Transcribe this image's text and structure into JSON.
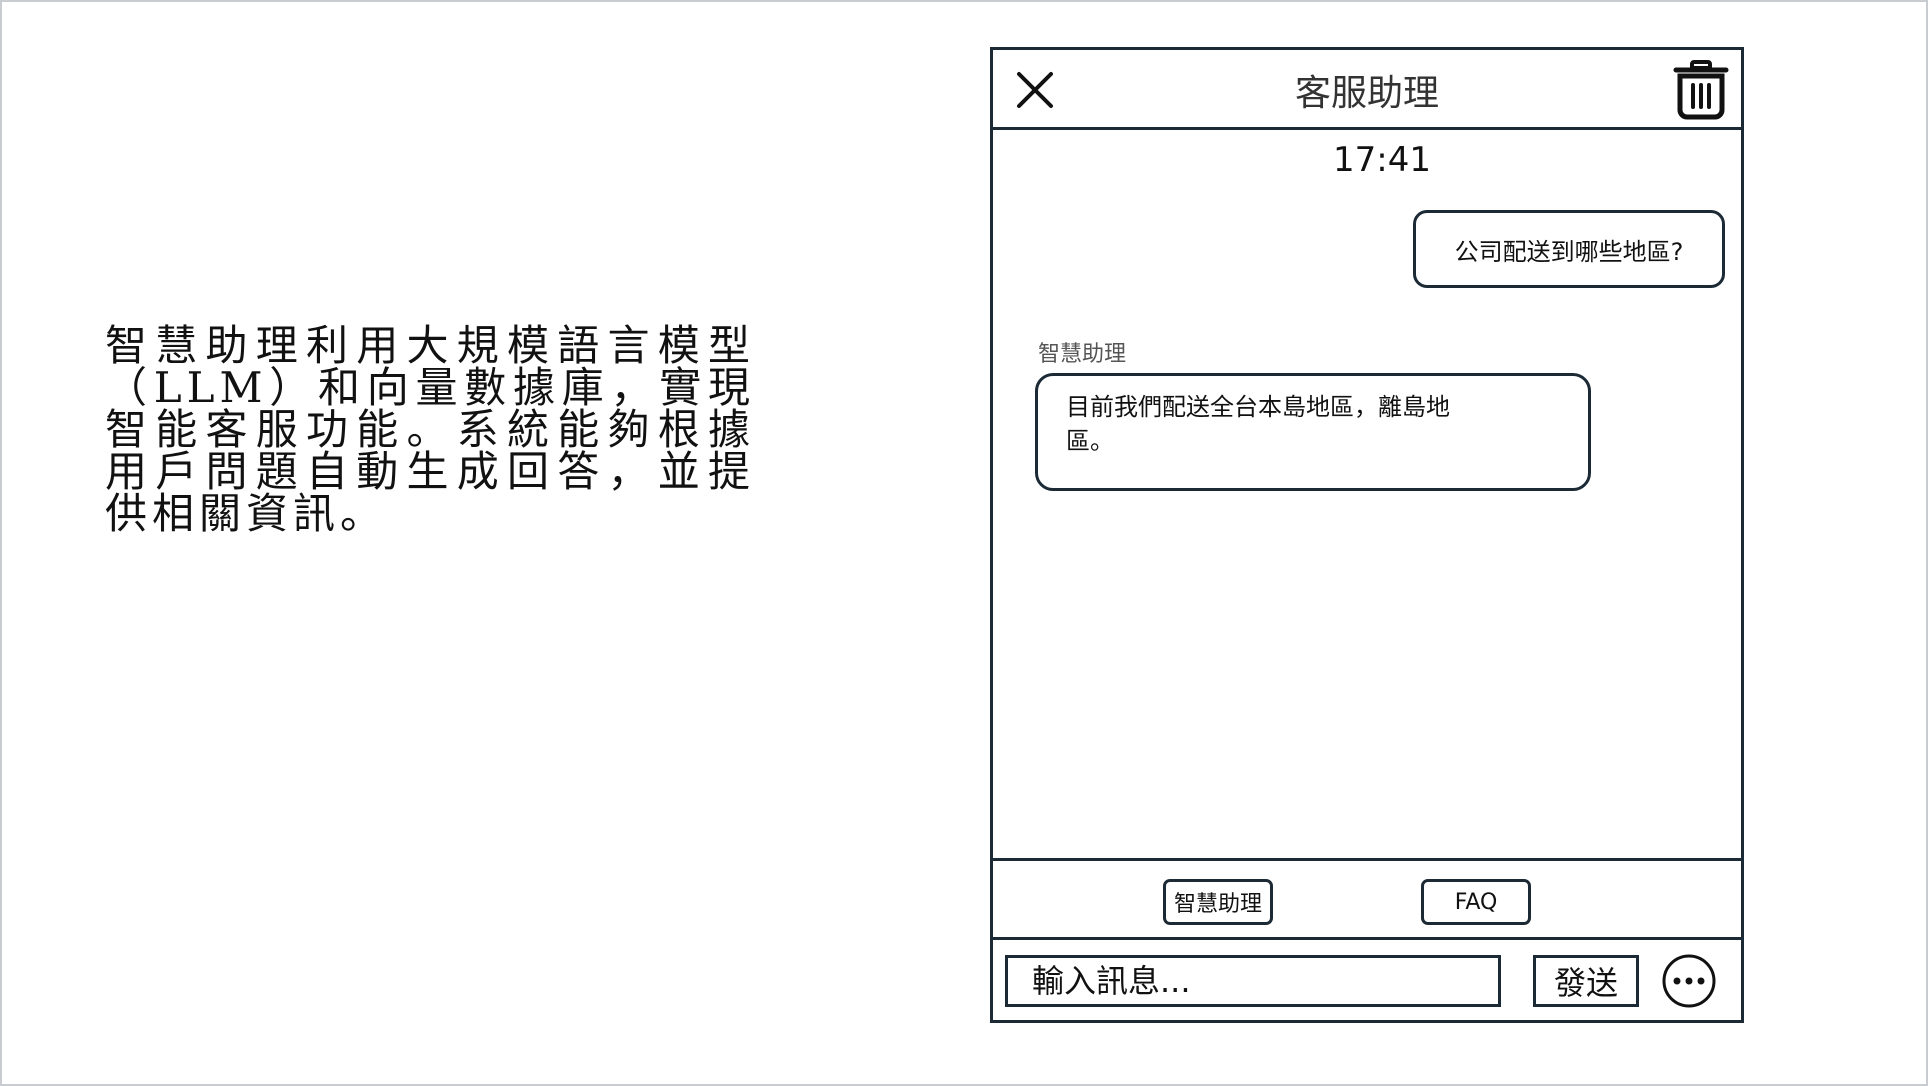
{
  "description": {
    "text": "智慧助理利用大規模語言模型（LLM）和向量數據庫，實現智能客服功能。系統能夠根據用戶問題自動生成回答，並提供相關資訊。"
  },
  "chat": {
    "header": {
      "title": "客服助理",
      "close_icon": "close-icon",
      "delete_icon": "trash-icon"
    },
    "timestamp": "17:41",
    "messages": [
      {
        "sender": "user",
        "text": "公司配送到哪些地區?"
      },
      {
        "sender": "bot",
        "name": "智慧助理",
        "text": "目前我們配送全台本島地區，離島地區。"
      }
    ],
    "chips": [
      {
        "label": "智慧助理"
      },
      {
        "label": "FAQ"
      }
    ],
    "input": {
      "placeholder": "輸入訊息...",
      "value": ""
    },
    "send_label": "發送",
    "more_icon": "more-icon"
  },
  "colors": {
    "border": "#1c2a36",
    "background": "#ffffff",
    "text": "#111111"
  }
}
